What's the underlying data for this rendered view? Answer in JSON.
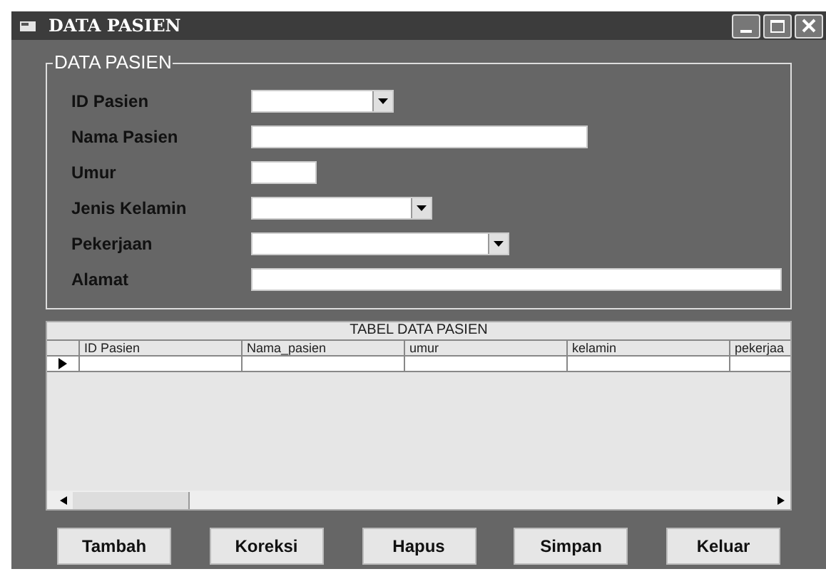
{
  "window": {
    "title": "DATA PASIEN"
  },
  "group": {
    "title": "DATA PASIEN",
    "fields": [
      {
        "label": "ID Pasien",
        "kind": "combo"
      },
      {
        "label": "Nama Pasien",
        "kind": "text"
      },
      {
        "label": "Umur",
        "kind": "text"
      },
      {
        "label": "Jenis Kelamin",
        "kind": "combo"
      },
      {
        "label": "Pekerjaan",
        "kind": "combo"
      },
      {
        "label": "Alamat",
        "kind": "text"
      }
    ]
  },
  "table": {
    "caption": "TABEL DATA PASIEN",
    "columns": [
      "ID Pasien",
      "Nama_pasien",
      "umur",
      "kelamin",
      "pekerjaa"
    ]
  },
  "buttons": [
    "Tambah",
    "Koreksi",
    "Hapus",
    "Simpan",
    "Keluar"
  ]
}
